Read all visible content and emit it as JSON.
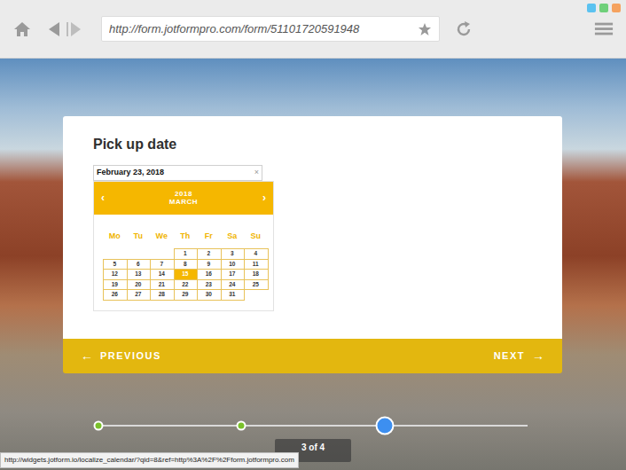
{
  "browser": {
    "url": "http://form.jotformpro.com/form/51101720591948",
    "status_url": "http://widgets.jotform.io/localize_calendar/?qid=8&ref=http%3A%2F%2Fform.jotformpro.com"
  },
  "form": {
    "title": "Pick up date",
    "date_value": "February 23, 2018",
    "clear": "×",
    "calendar": {
      "prev": "‹",
      "next": "›",
      "year": "2018",
      "month": "MARCH",
      "weekdays": [
        "Mo",
        "Tu",
        "We",
        "Th",
        "Fr",
        "Sa",
        "Su"
      ],
      "days": [
        {
          "label": "1",
          "selected": false
        },
        {
          "label": "2",
          "selected": false
        },
        {
          "label": "3",
          "selected": false
        },
        {
          "label": "4",
          "selected": false
        },
        {
          "label": "5",
          "selected": false
        },
        {
          "label": "6",
          "selected": false
        },
        {
          "label": "7",
          "selected": false
        },
        {
          "label": "8",
          "selected": false
        },
        {
          "label": "9",
          "selected": false
        },
        {
          "label": "10",
          "selected": false
        },
        {
          "label": "11",
          "selected": false
        },
        {
          "label": "12",
          "selected": false
        },
        {
          "label": "13",
          "selected": false
        },
        {
          "label": "14",
          "selected": false
        },
        {
          "label": "15",
          "selected": true
        },
        {
          "label": "16",
          "selected": false
        },
        {
          "label": "17",
          "selected": false
        },
        {
          "label": "18",
          "selected": false
        },
        {
          "label": "19",
          "selected": false
        },
        {
          "label": "20",
          "selected": false
        },
        {
          "label": "21",
          "selected": false
        },
        {
          "label": "22",
          "selected": false
        },
        {
          "label": "23",
          "selected": false
        },
        {
          "label": "24",
          "selected": false
        },
        {
          "label": "25",
          "selected": false
        },
        {
          "label": "26",
          "selected": false
        },
        {
          "label": "27",
          "selected": false
        },
        {
          "label": "28",
          "selected": false
        },
        {
          "label": "29",
          "selected": false
        },
        {
          "label": "30",
          "selected": false
        },
        {
          "label": "31",
          "selected": false
        }
      ]
    }
  },
  "nav": {
    "previous_arrow": "←",
    "previous": "PREVIOUS",
    "next": "NEXT",
    "next_arrow": "→"
  },
  "progress": {
    "steps": [
      {
        "kind": "done"
      },
      {
        "kind": "done"
      },
      {
        "kind": "current"
      },
      {
        "kind": "todo"
      }
    ],
    "label": "3 of 4"
  }
}
